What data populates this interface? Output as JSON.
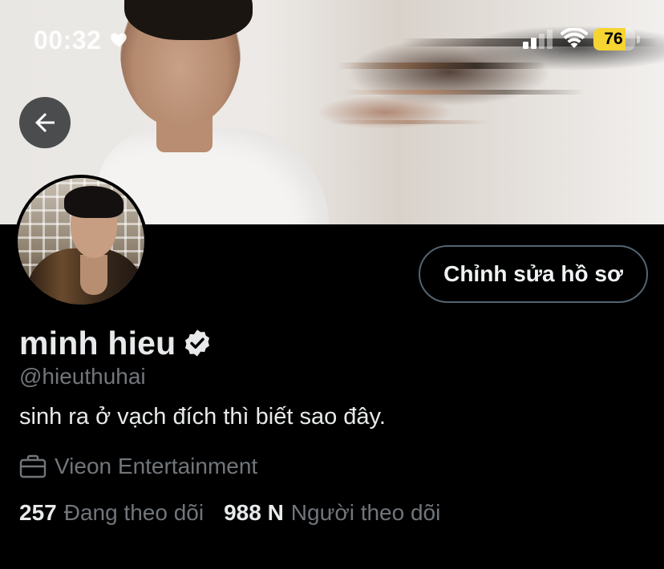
{
  "status_bar": {
    "time": "00:32",
    "battery_level": "76",
    "battery_fraction": 0.76,
    "battery_color": "#f6d431",
    "icons": [
      "heart-icon",
      "signal-icon",
      "wifi-icon",
      "battery-icon"
    ]
  },
  "header": {
    "back_icon": "arrow-left-icon",
    "banner": "profile-banner-photo"
  },
  "profile": {
    "avatar": "profile-avatar-photo",
    "edit_button_label": "Chỉnh sửa hồ sơ",
    "display_name": "minh hieu",
    "verified_icon": "verified-badge-icon",
    "handle": "@hieuthuhai",
    "bio": "sinh ra ở vạch đích thì biết sao đây.",
    "affiliation_icon": "briefcase-icon",
    "affiliation": "Vieon Entertainment",
    "following_count": "257",
    "following_label": "Đang theo dõi",
    "followers_count": "988 N",
    "followers_label": "Người theo dõi"
  },
  "colors": {
    "background": "#000000",
    "primary_text": "#e7e9ea",
    "secondary_text": "#71767b",
    "button_border": "#536471"
  }
}
